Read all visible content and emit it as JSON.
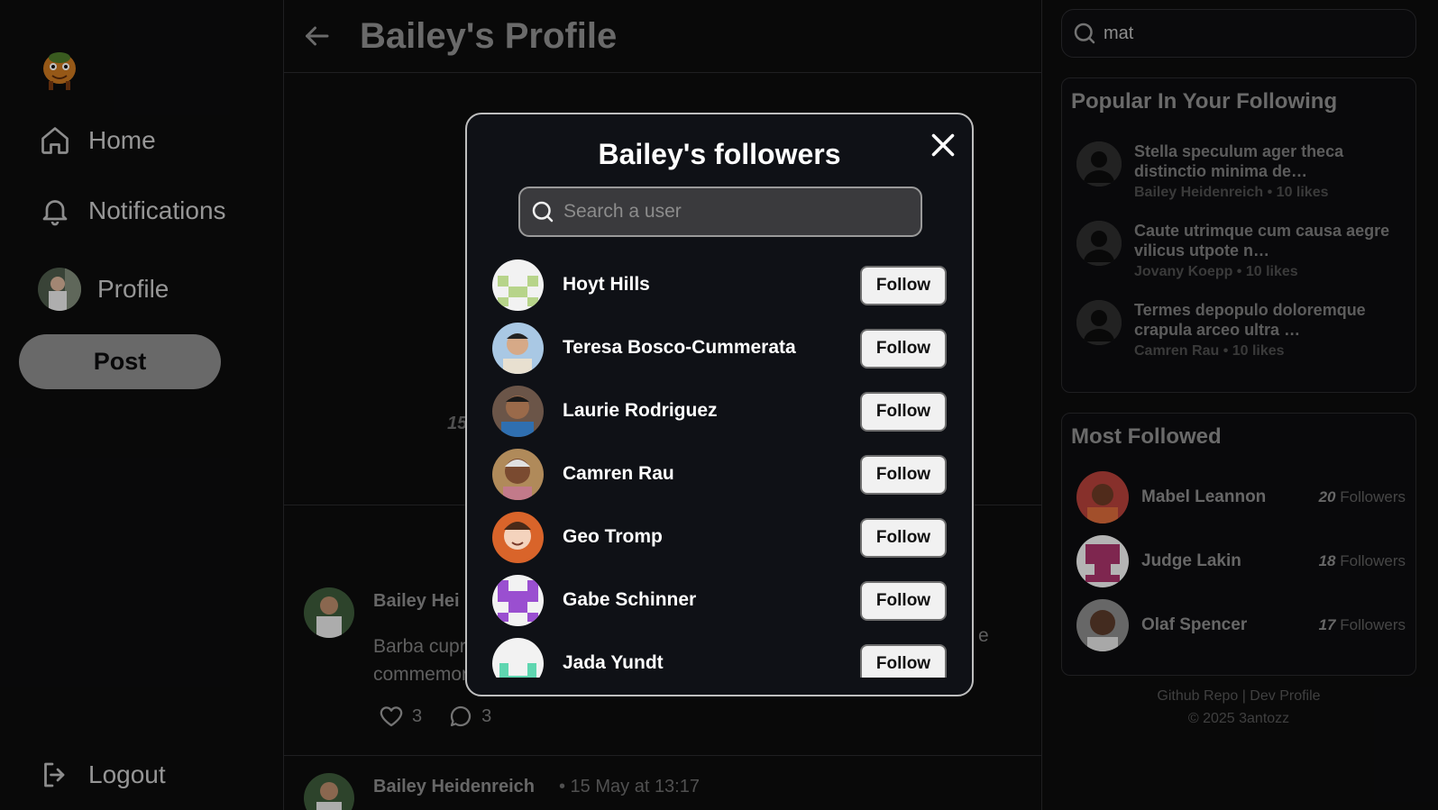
{
  "sidebar": {
    "nav": [
      {
        "label": "Home",
        "icon": "home-icon"
      },
      {
        "label": "Notifications",
        "icon": "bell-icon"
      },
      {
        "label": "Profile",
        "icon": "avatar"
      }
    ],
    "post_label": "Post",
    "logout_label": "Logout"
  },
  "main": {
    "title": "Bailey's Profile",
    "stat_partial": "15",
    "posts": [
      {
        "author": "Bailey Hei",
        "text_left": "Barba cupr",
        "text_left2": "commemor",
        "text_right": "e",
        "likes": "3",
        "comments": "3"
      },
      {
        "author": "Bailey Heidenreich",
        "time": "• 15 May at 13:17"
      }
    ]
  },
  "right": {
    "search_value": "mat",
    "popular": {
      "title": "Popular In Your Following",
      "items": [
        {
          "title": "Stella speculum ager theca distinctio minima de…",
          "meta": "Bailey Heidenreich • 10 likes"
        },
        {
          "title": "Caute utrimque cum causa aegre vilicus utpote n…",
          "meta": "Jovany Koepp • 10 likes"
        },
        {
          "title": "Termes depopulo doloremque crapula arceo ultra …",
          "meta": "Camren Rau • 10 likes"
        }
      ]
    },
    "most_followed": {
      "title": "Most Followed",
      "items": [
        {
          "name": "Mabel Leannon",
          "count": "20",
          "suffix": "Followers"
        },
        {
          "name": "Judge Lakin",
          "count": "18",
          "suffix": "Followers"
        },
        {
          "name": "Olaf Spencer",
          "count": "17",
          "suffix": "Followers"
        }
      ]
    },
    "footer": {
      "line1": "Github Repo | Dev Profile",
      "line2": "© 2025 3antozz"
    }
  },
  "modal": {
    "title": "Bailey's followers",
    "search_placeholder": "Search a user",
    "follow_label": "Follow",
    "followers": [
      {
        "name": "Hoyt Hills"
      },
      {
        "name": "Teresa Bosco-Cummerata"
      },
      {
        "name": "Laurie Rodriguez"
      },
      {
        "name": "Camren Rau"
      },
      {
        "name": "Geo Tromp"
      },
      {
        "name": "Gabe Schinner"
      },
      {
        "name": "Jada Yundt"
      }
    ]
  },
  "colors": {
    "accent_button": "#8c8c8c",
    "modal_bg": "#0f1116",
    "identicon_green": "#b7d48a",
    "identicon_purple": "#9a4fd0",
    "identicon_pink": "#a8336a",
    "identicon_teal": "#5fd6b0"
  }
}
